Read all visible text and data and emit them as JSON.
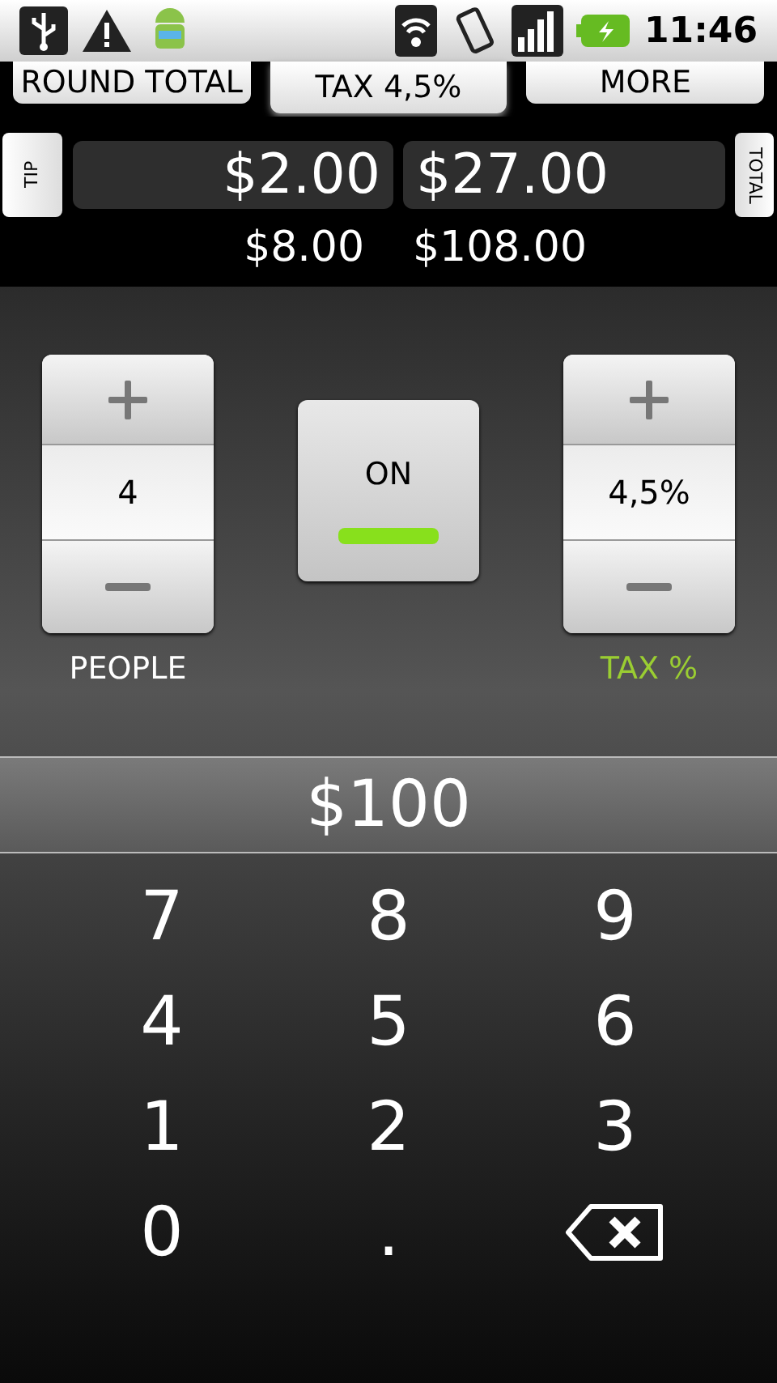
{
  "status_bar": {
    "time": "11:46"
  },
  "tabs": [
    {
      "label": "ROUND TOTAL",
      "selected": false
    },
    {
      "label": "TAX 4,5%",
      "selected": true
    },
    {
      "label": "MORE",
      "selected": false
    }
  ],
  "results": {
    "tip_label": "TIP",
    "total_label": "TOTAL",
    "tip": "$2.00",
    "total": "$27.00",
    "tip_all": "$8.00",
    "total_all": "$108.00"
  },
  "people": {
    "value": "4",
    "label": "PEOPLE",
    "highlighted": false
  },
  "toggle": {
    "label": "ON",
    "on": true
  },
  "tax": {
    "value": "4,5%",
    "label": "TAX %",
    "highlighted": true
  },
  "amount": "$100",
  "keys": [
    {
      "kind": "digit",
      "label": "7"
    },
    {
      "kind": "digit",
      "label": "8"
    },
    {
      "kind": "digit",
      "label": "9"
    },
    {
      "kind": "digit",
      "label": "4"
    },
    {
      "kind": "digit",
      "label": "5"
    },
    {
      "kind": "digit",
      "label": "6"
    },
    {
      "kind": "digit",
      "label": "1"
    },
    {
      "kind": "digit",
      "label": "2"
    },
    {
      "kind": "digit",
      "label": "3"
    },
    {
      "kind": "digit",
      "label": "0"
    },
    {
      "kind": "digit",
      "label": "."
    },
    {
      "kind": "backspace"
    }
  ]
}
